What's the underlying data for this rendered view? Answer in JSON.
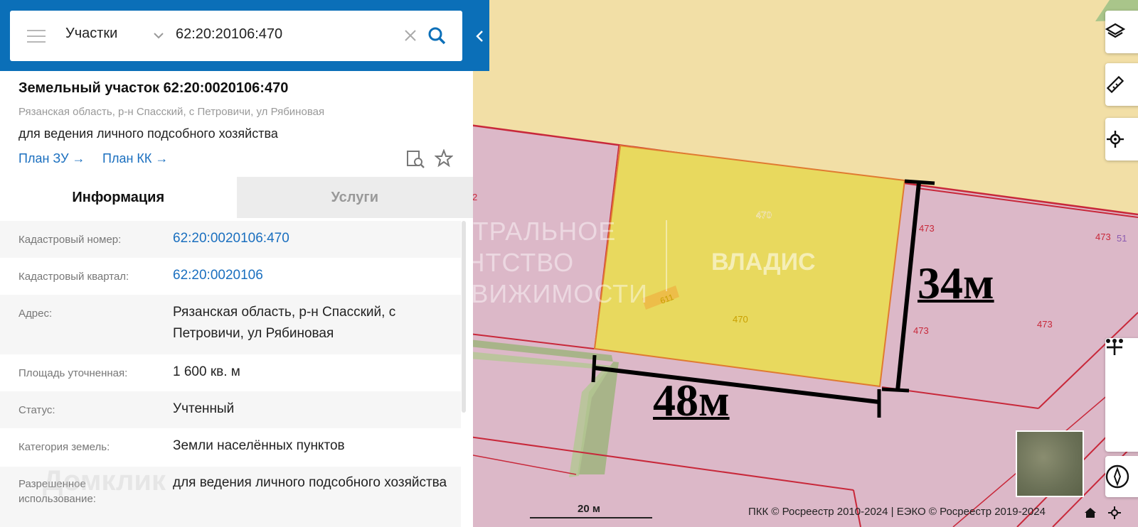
{
  "search": {
    "layer": "Участки",
    "query": "62:20:20106:470"
  },
  "parcel": {
    "title": "Земельный участок 62:20:0020106:470",
    "address_short": "Рязанская область, р-н Спасский, с Петровичи, ул Рябиновая",
    "purpose": "для ведения личного подсобного хозяйства",
    "link_plan_zu": "План ЗУ →",
    "link_plan_kk": "План КК →"
  },
  "tabs": [
    "Информация",
    "Услуги"
  ],
  "info_rows": [
    {
      "label": "Кадастровый номер:",
      "value": "62:20:0020106:470"
    },
    {
      "label": "Кадастровый квартал:",
      "value": "62:20:0020106"
    },
    {
      "label": "Адрес:",
      "value": "Рязанская область, р-н Спасский, с Петровичи, ул Рябиновая"
    },
    {
      "label": "Площадь уточненная:",
      "value": "1 600 кв. м"
    },
    {
      "label": "Статус:",
      "value": "Учтенный"
    },
    {
      "label": "Категория земель:",
      "value": "Земли населённых пунктов"
    },
    {
      "label": "Разрешенное использование:",
      "value": "для ведения личного подсобного хозяйства"
    }
  ],
  "map": {
    "parcel_labels": [
      "470",
      "470",
      "611",
      "473",
      "473",
      "473",
      "473",
      "2",
      "51"
    ],
    "dimension_width": "48м",
    "dimension_height": "34м",
    "scale_label": "20 м",
    "attribution": "ПКК © Росреестр 2010-2024 | ЕЭКО © Росреестр 2019-2024",
    "watermark_agency": "ЦЕНТРАЛЬНОЕ\nАГЕНТСТВО\nНЕДВИЖИМОСТИ",
    "watermark_brand": "ВЛАДИС",
    "watermark_domclick": "Домклик"
  },
  "colors": {
    "header_blue": "#0b6fb8",
    "link_blue": "#1a6fbf",
    "parcel_fill": "#e8d95e",
    "zone_pink": "#dcb8c8",
    "zone_sand": "#f2dfa6",
    "boundary_red": "#c8283a"
  }
}
